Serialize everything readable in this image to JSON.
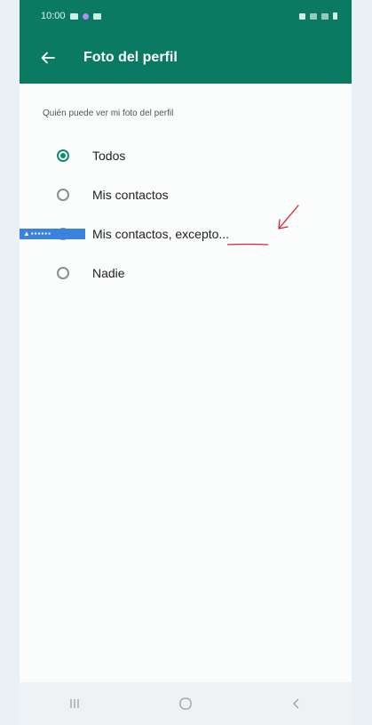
{
  "status_bar": {
    "time": "10:00"
  },
  "app_bar": {
    "title": "Foto del perfil"
  },
  "section": {
    "label": "Quién puede ver mi foto del perfil"
  },
  "options": [
    {
      "label": "Todos",
      "selected": true
    },
    {
      "label": "Mis contactos",
      "selected": false
    },
    {
      "label": "Mis contactos, excepto...",
      "selected": false
    },
    {
      "label": "Nadie",
      "selected": false
    }
  ],
  "colors": {
    "accent": "#0b7a63",
    "radio_selected": "#0b8c6f",
    "annotation": "#d9262e",
    "overlay_badge": "#3b82e0"
  },
  "icons": [
    "back-arrow-icon",
    "recents-icon",
    "home-icon",
    "back-nav-icon"
  ]
}
